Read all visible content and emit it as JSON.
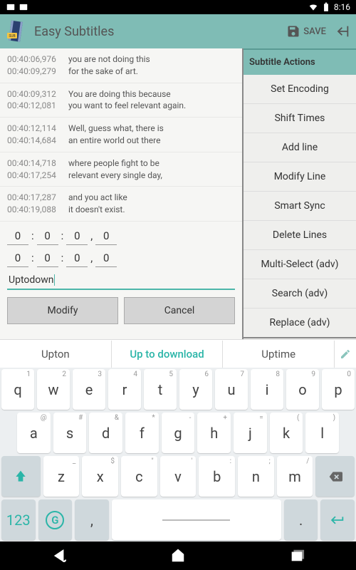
{
  "statusbar": {
    "time": "8:16"
  },
  "appbar": {
    "title": "Easy Subtitles",
    "save": "SAVE"
  },
  "subtitles": [
    {
      "start": "00:40:06,976",
      "end": "00:40:09,279",
      "l1": "you are not doing this",
      "l2": "for the sake of art."
    },
    {
      "start": "00:40:09,312",
      "end": "00:40:12,081",
      "l1": "You are doing this because",
      "l2": "you want to feel relevant again."
    },
    {
      "start": "00:40:12,114",
      "end": "00:40:14,684",
      "l1": "Well, guess what, there is",
      "l2": "an entire world out there"
    },
    {
      "start": "00:40:14,718",
      "end": "00:40:17,254",
      "l1": "where people fight to be",
      "l2": "relevant every single day,"
    },
    {
      "start": "00:40:17,287",
      "end": "00:40:19,088",
      "l1": "and you act like",
      "l2": "it doesn't exist."
    }
  ],
  "editor": {
    "t1": [
      "0",
      "0",
      "0",
      "0"
    ],
    "t2": [
      "0",
      "0",
      "0",
      "0"
    ],
    "text": "Uptodown",
    "modify": "Modify",
    "cancel": "Cancel"
  },
  "actions": {
    "header": "Subtitle Actions",
    "items": [
      "Set Encoding",
      "Shift Times",
      "Add line",
      "Modify Line",
      "Smart Sync",
      "Delete Lines",
      "Multi-Select (adv)",
      "Search (adv)",
      "Replace (adv)"
    ]
  },
  "suggestions": [
    "Upton",
    "Up to download",
    "Uptime"
  ],
  "keyboard": {
    "r1": [
      [
        "q",
        "1"
      ],
      [
        "w",
        "2"
      ],
      [
        "e",
        "3"
      ],
      [
        "r",
        "4"
      ],
      [
        "t",
        "5"
      ],
      [
        "y",
        "6"
      ],
      [
        "u",
        "7"
      ],
      [
        "i",
        "8"
      ],
      [
        "o",
        "9"
      ],
      [
        "p",
        "0"
      ]
    ],
    "r2": [
      [
        "a",
        "@"
      ],
      [
        "s",
        "#"
      ],
      [
        "d",
        "&"
      ],
      [
        "f",
        "*"
      ],
      [
        "g",
        "-"
      ],
      [
        "h",
        "+"
      ],
      [
        "j",
        "="
      ],
      [
        "k",
        "("
      ],
      [
        "l",
        ")"
      ]
    ],
    "r3": [
      [
        "z",
        "_"
      ],
      [
        "x",
        "$"
      ],
      [
        "c",
        "\""
      ],
      [
        "v",
        "'"
      ],
      [
        "b",
        ":"
      ],
      [
        "n",
        ";"
      ],
      [
        "m",
        "/"
      ]
    ],
    "num": "123",
    "comma": ",",
    "period": "."
  }
}
